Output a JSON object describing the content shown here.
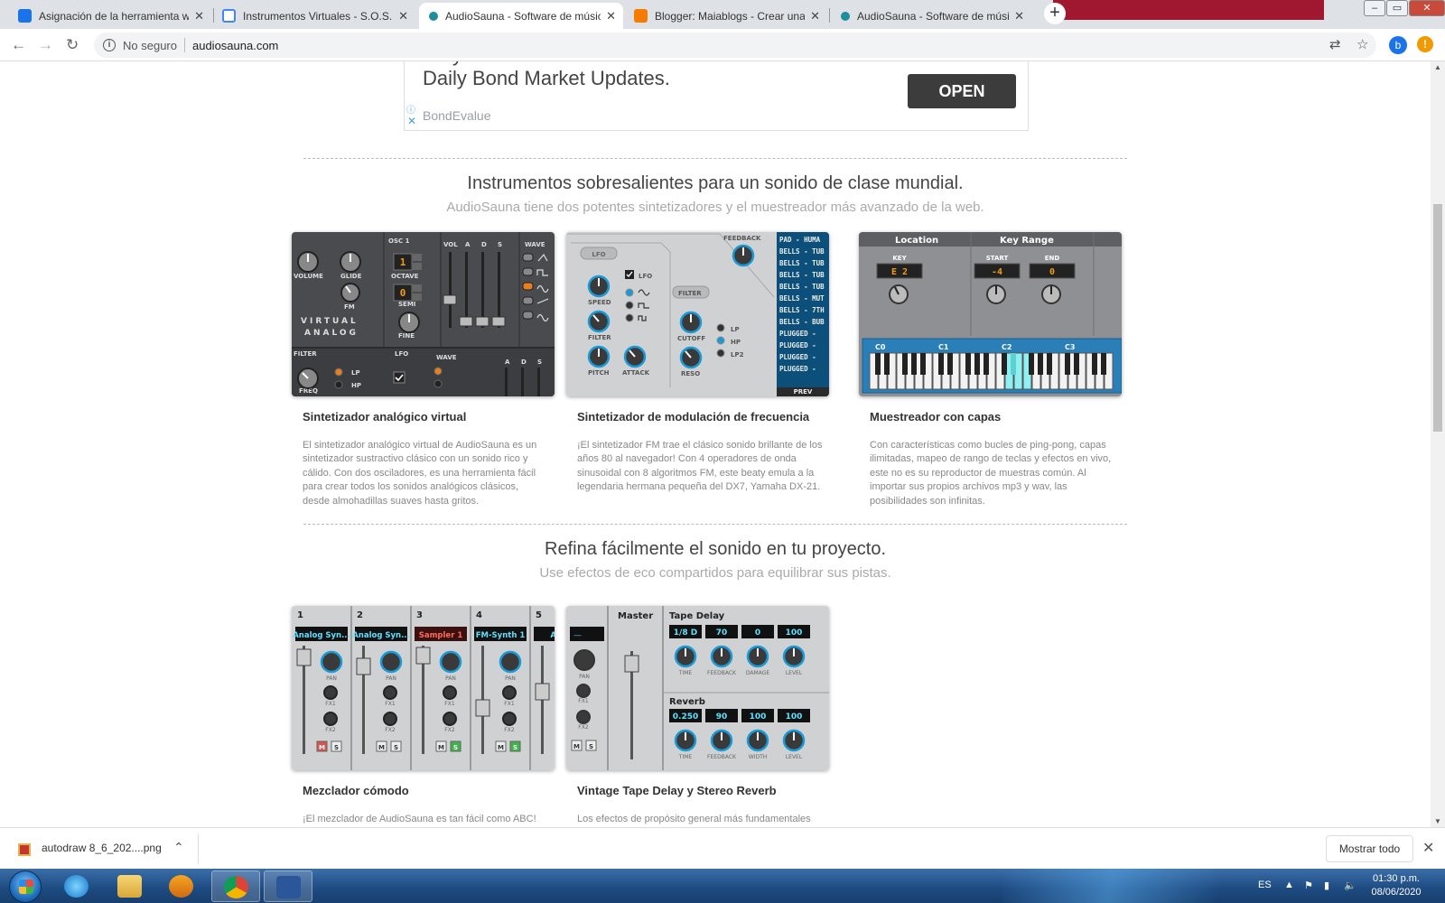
{
  "browser": {
    "tabs": [
      {
        "label": "Asignación de la herramienta web",
        "favicon_color": "#1a73e8"
      },
      {
        "label": "Instrumentos Virtuales - S.O.S. pa",
        "favicon_color": "#4285f4"
      },
      {
        "label": "AudioSauna - Software de músic",
        "favicon_color": "#1e8e9e"
      },
      {
        "label": "Blogger: Maiablogs - Crear una e",
        "favicon_color": "#f57c00"
      },
      {
        "label": "AudioSauna - Software de músic",
        "favicon_color": "#1e8e9e"
      }
    ],
    "active_tab": 2,
    "new_tab": "+",
    "window_controls": [
      "–",
      "▭",
      "✕"
    ],
    "security_label": "No seguro",
    "url": "audiosauna.com",
    "profile_initial": "b",
    "alert_glyph": "!"
  },
  "ad": {
    "headline": "Stay Informed with Curated News on Bond Issuers & Daily Bond Market Updates.",
    "sponsor": "BondEvalue",
    "cta": "OPEN"
  },
  "section_instruments": {
    "title": "Instrumentos sobresalientes para un sonido de clase mundial.",
    "subtitle": "AudioSauna tiene dos potentes sintetizadores y el muestreador más avanzado de la web.",
    "cards": [
      {
        "title": "Sintetizador analógico virtual",
        "description": "El sintetizador analógico virtual de AudioSauna es un sintetizador sustractivo clásico con un sonido rico y cálido. Con dos osciladores, es una herramienta fácil para crear todos los sonidos analógicos clásicos, desde almohadillas suaves hasta gritos."
      },
      {
        "title": "Sintetizador de modulación de frecuencia",
        "description": "¡El sintetizador FM trae el clásico sonido brillante de los años 80 al navegador! Con 4 operadores de onda sinusoidal con 8 algoritmos FM, este beaty emula a la legendaria hermana pequeña del DX7, Yamaha DX-21."
      },
      {
        "title": "Muestreador con capas",
        "description": "Con características como bucles de ping-pong, capas ilimitadas, mapeo de rango de teclas y efectos en vivo, este no es su reproductor de muestras común. Al importar sus propios archivos mp3 y wav, las posibilidades son infinitas."
      }
    ]
  },
  "section_mix": {
    "title": "Refina fácilmente el sonido en tu proyecto.",
    "subtitle": "Use efectos de eco compartidos para equilibrar sus pistas.",
    "cards": [
      {
        "title": "Mezclador cómodo",
        "description": "¡El mezclador de AudioSauna es tan fácil como ABC!"
      },
      {
        "title": "Vintage Tape Delay y Stereo Reverb",
        "description": "Los efectos de propósito general más fundamentales"
      }
    ]
  },
  "synth_va": {
    "labels": [
      "VOLUME",
      "GLIDE",
      "FM",
      "OSC 1",
      "OCTAVE",
      "SEMI",
      "FINE",
      "VOL",
      "A",
      "D",
      "S",
      "WAVE",
      "VIRTUAL",
      "ANALOG",
      "FILTER",
      "FREQ",
      "LP",
      "HP",
      "LFO",
      "WAVE",
      "A",
      "D",
      "S"
    ],
    "octave": "1",
    "semi": "0"
  },
  "synth_fm": {
    "labels": [
      "LFO",
      "LFO",
      "SPEED",
      "FILTER",
      "PITCH",
      "ATTACK",
      "FILTER",
      "CUTOFF",
      "RESO",
      "LP",
      "HP",
      "LP2",
      "FEEDBACK",
      "PREV"
    ],
    "patches": [
      "PAD - HUMA",
      "BELLS - TUB",
      "BELLS - TUB",
      "BELLS - TUB",
      "BELLS - TUB",
      "BELLS - MUT",
      "BELLS - 7TH",
      "BELLS - BUB",
      "PLUGGED -",
      "PLUGGED -",
      "PLUGGED -",
      "PLUGGED -"
    ]
  },
  "sampler": {
    "location": "Location",
    "key_range": "Key Range",
    "key_label": "KEY",
    "key_value": "E 2",
    "start_label": "START",
    "start_value": "-4",
    "end_label": "END",
    "end_value": "0",
    "octaves": [
      "C0",
      "C1",
      "C2",
      "C3"
    ]
  },
  "mixer": {
    "channels": [
      {
        "num": "1",
        "name": "Analog Syn..."
      },
      {
        "num": "2",
        "name": "Analog Syn..."
      },
      {
        "num": "3",
        "name": "Sampler 1"
      },
      {
        "num": "4",
        "name": "FM-Synth 1"
      },
      {
        "num": "5",
        "name": "Anal"
      }
    ],
    "knob_labels": [
      "PAN",
      "FX1",
      "FX2"
    ],
    "mute": "M",
    "solo": "S"
  },
  "effects": {
    "master_label": "Master",
    "master_display": "—",
    "tape_delay": "Tape Delay",
    "delay_values": [
      "1/8 D",
      "70",
      "0",
      "100"
    ],
    "delay_labels": [
      "TIME",
      "FEEDBACK",
      "DAMAGE",
      "LEVEL"
    ],
    "reverb": "Reverb",
    "reverb_values": [
      "0.250",
      "90",
      "100",
      "100"
    ],
    "reverb_labels": [
      "TIME",
      "FEEDBACK",
      "WIDTH",
      "LEVEL"
    ]
  },
  "downloads": {
    "file": "autodraw 8_6_202....png",
    "show_all": "Mostrar todo"
  },
  "taskbar": {
    "language": "ES",
    "time": "01:30 p.m.",
    "date": "08/06/2020"
  }
}
